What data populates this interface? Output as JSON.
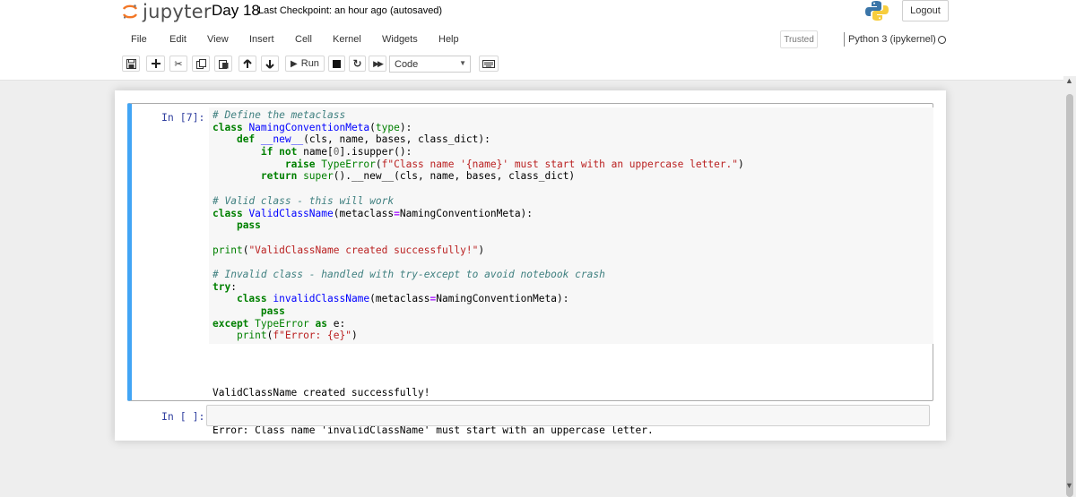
{
  "header": {
    "logo_text": "jupyter",
    "notebook_name": "Day 18",
    "checkpoint": "Last Checkpoint: an hour ago",
    "autosaved": "(autosaved)",
    "logout_label": "Logout"
  },
  "menu": {
    "items": [
      "File",
      "Edit",
      "View",
      "Insert",
      "Cell",
      "Kernel",
      "Widgets",
      "Help"
    ]
  },
  "status": {
    "trusted": "Trusted",
    "kernel": "Python 3 (ipykernel)"
  },
  "toolbar": {
    "run_label": "Run",
    "cell_type": "Code",
    "icons": [
      "save-icon",
      "plus-icon",
      "cut-icon",
      "copy-icon",
      "paste-icon",
      "arrow-up-icon",
      "arrow-down-icon",
      "run-icon",
      "stop-icon",
      "restart-icon",
      "fast-forward-icon",
      "keyboard-icon"
    ]
  },
  "cells": [
    {
      "prompt": "In [7]:",
      "code": [
        "# Define the metaclass",
        "class NamingConventionMeta(type):",
        "    def __new__(cls, name, bases, class_dict):",
        "        if not name[0].isupper():",
        "            raise TypeError(f\"Class name '{name}' must start with an uppercase letter.\")",
        "        return super().__new__(cls, name, bases, class_dict)",
        "",
        "# Valid class - this will work",
        "class ValidClassName(metaclass=NamingConventionMeta):",
        "    pass",
        "",
        "print(\"ValidClassName created successfully!\")",
        "",
        "# Invalid class - handled with try-except to avoid notebook crash",
        "try:",
        "    class invalidClassName(metaclass=NamingConventionMeta):",
        "        pass",
        "except TypeError as e:",
        "    print(f\"Error: {e}\")"
      ],
      "output": [
        "ValidClassName created successfully!",
        "Error: Class name 'invalidClassName' must start with an uppercase letter."
      ]
    },
    {
      "prompt": "In [ ]:",
      "code": []
    }
  ]
}
